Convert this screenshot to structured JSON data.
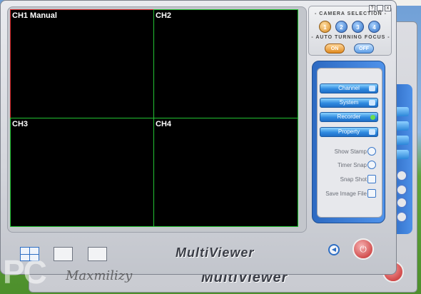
{
  "grid": {
    "channels": [
      "CH1 Manual",
      "CH2",
      "CH3",
      "CH4"
    ],
    "active_channel_index": 0
  },
  "camera_selection": {
    "heading": "- CAMERA SELECTION -",
    "buttons": [
      "1",
      "2",
      "3",
      "4"
    ],
    "selected_index": 0,
    "auto_focus_heading": "- AUTO TURNING FOCUS -",
    "toggle_on": "ON",
    "toggle_off": "OFF"
  },
  "menu": {
    "items": [
      "Channel",
      "System",
      "Recorder",
      "Property"
    ]
  },
  "actions": {
    "items": [
      "Show Stamp",
      "Timer Snap",
      "Snap Shot",
      "Save Image File"
    ]
  },
  "bottom": {
    "logo": "MultiViewer",
    "ghost_logo": "MultiViewer"
  },
  "window_controls": [
    "?",
    "_",
    "x"
  ],
  "overlay": {
    "watermark": "PC",
    "signature": "Maxmilizy"
  },
  "colors": {
    "grid_border": "#22c233",
    "active_border": "#d62626",
    "accent": "#2f6fc4"
  }
}
